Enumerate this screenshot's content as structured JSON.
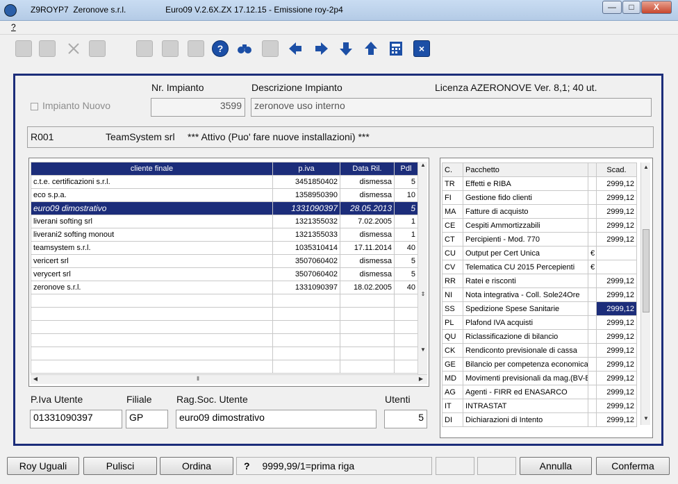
{
  "window": {
    "title": "Z9ROYP7  Zeronove s.r.l.                 Euro09 V.2.6X.ZX 17.12.15 - Emissione roy-2p4",
    "minimize": "—",
    "maximize": "□",
    "close": "X"
  },
  "menu": {
    "help": "?"
  },
  "toolbar": {
    "help_glyph": "?",
    "close_glyph": "×",
    "buttons": [
      "save-icon",
      "save-all-icon",
      "delete-icon",
      "print-icon",
      "copy-icon",
      "document-icon",
      "report-icon",
      "help-icon",
      "binoculars-icon",
      "transfer-icon",
      "arrow-left-icon",
      "arrow-right-icon",
      "arrow-down-icon",
      "arrow-up-icon",
      "calculator-icon",
      "close-icon"
    ]
  },
  "form": {
    "impianto_nuovo_label": "Impianto Nuovo",
    "nr_impianto_label": "Nr. Impianto",
    "nr_impianto_value": "3599",
    "descrizione_label": "Descrizione Impianto",
    "descrizione_value": "zeronove uso interno",
    "licenza_label": "Licenza AZERONOVE  Ver. 8,1; 40  ut.",
    "licenza_code": "R001",
    "licenza_company": "TeamSystem srl",
    "licenza_status": "*** Attivo (Puo' fare nuove installazioni) ***"
  },
  "clients": {
    "headers": [
      "cliente finale",
      "p.iva",
      "Data Ril.",
      "Pdl"
    ],
    "rows": [
      {
        "name": "c.t.e. certificazioni s.r.l.",
        "piva": "3451850402",
        "data": "dismessa",
        "pdl": "5"
      },
      {
        "name": "eco s.p.a.",
        "piva": "1358950390",
        "data": "dismessa",
        "pdl": "10"
      },
      {
        "name": "euro09 dimostrativo",
        "piva": "1331090397",
        "data": "28.05.2013",
        "pdl": "5"
      },
      {
        "name": "liverani softing srl",
        "piva": "1321355032",
        "data": "7.02.2005",
        "pdl": "1"
      },
      {
        "name": "liverani2 softing monout",
        "piva": "1321355033",
        "data": "dismessa",
        "pdl": "1"
      },
      {
        "name": "teamsystem s.r.l.",
        "piva": "1035310414",
        "data": "17.11.2014",
        "pdl": "40"
      },
      {
        "name": "vericert srl",
        "piva": "3507060402",
        "data": "dismessa",
        "pdl": "5"
      },
      {
        "name": "verycert srl",
        "piva": "3507060402",
        "data": "dismessa",
        "pdl": "5"
      },
      {
        "name": "zeronove s.r.l.",
        "piva": "1331090397",
        "data": "18.02.2005",
        "pdl": "40"
      }
    ],
    "selected_index": 2
  },
  "user": {
    "piva_label": "P.Iva Utente",
    "piva_value": "01331090397",
    "filiale_label": "Filiale",
    "filiale_value": "GP",
    "ragsoc_label": "Rag.Soc. Utente",
    "ragsoc_value": "euro09 dimostrativo",
    "utenti_label": "Utenti",
    "utenti_value": "5"
  },
  "packages": {
    "headers": [
      "C.",
      "Pacchetto",
      "",
      "Scad."
    ],
    "rows": [
      {
        "code": "TR",
        "name": "Effetti e RIBA",
        "cur": "",
        "scad": "2999,12"
      },
      {
        "code": "FI",
        "name": "Gestione fido clienti",
        "cur": "",
        "scad": "2999,12"
      },
      {
        "code": "MA",
        "name": "Fatture di acquisto",
        "cur": "",
        "scad": "2999,12"
      },
      {
        "code": "CE",
        "name": "Cespiti Ammortizzabili",
        "cur": "",
        "scad": "2999,12"
      },
      {
        "code": "CT",
        "name": "Percipienti - Mod. 770",
        "cur": "",
        "scad": "2999,12"
      },
      {
        "code": "CU",
        "name": "Output per Cert Unica",
        "cur": "€",
        "scad": ""
      },
      {
        "code": "CV",
        "name": "Telematica CU 2015 Percepienti",
        "cur": "€",
        "scad": ""
      },
      {
        "code": "RR",
        "name": "Ratei e risconti",
        "cur": "",
        "scad": "2999,12"
      },
      {
        "code": "NI",
        "name": "Nota integrativa - Coll. Sole24Ore",
        "cur": "",
        "scad": "2999,12"
      },
      {
        "code": "SS",
        "name": "Spedizione Spese Sanitarie",
        "cur": "",
        "scad": "2999,12"
      },
      {
        "code": "PL",
        "name": "Plafond IVA acquisti",
        "cur": "",
        "scad": "2999,12"
      },
      {
        "code": "QU",
        "name": "Riclassificazione di bilancio",
        "cur": "",
        "scad": "2999,12"
      },
      {
        "code": "CK",
        "name": "Rendiconto previsionale di cassa",
        "cur": "",
        "scad": "2999,12"
      },
      {
        "code": "GE",
        "name": "Bilancio per competenza economica",
        "cur": "",
        "scad": "2999,12"
      },
      {
        "code": "MD",
        "name": "Movimenti previsionali da mag.(BV-B",
        "cur": "",
        "scad": "2999,12"
      },
      {
        "code": "AG",
        "name": "Agenti - FIRR ed ENASARCO",
        "cur": "",
        "scad": "2999,12"
      },
      {
        "code": "IT",
        "name": "INTRASTAT",
        "cur": "",
        "scad": "2999,12"
      },
      {
        "code": "DI",
        "name": "Dichiarazioni di Intento",
        "cur": "",
        "scad": "2999,12"
      }
    ],
    "highlighted_index": 9
  },
  "status": {
    "roy_uguali": "Roy Uguali",
    "pulisci": "Pulisci",
    "ordina": "Ordina",
    "hint_key": "?",
    "hint_text": "9999,99/1=prima riga",
    "annulla": "Annulla",
    "conferma": "Conferma"
  }
}
